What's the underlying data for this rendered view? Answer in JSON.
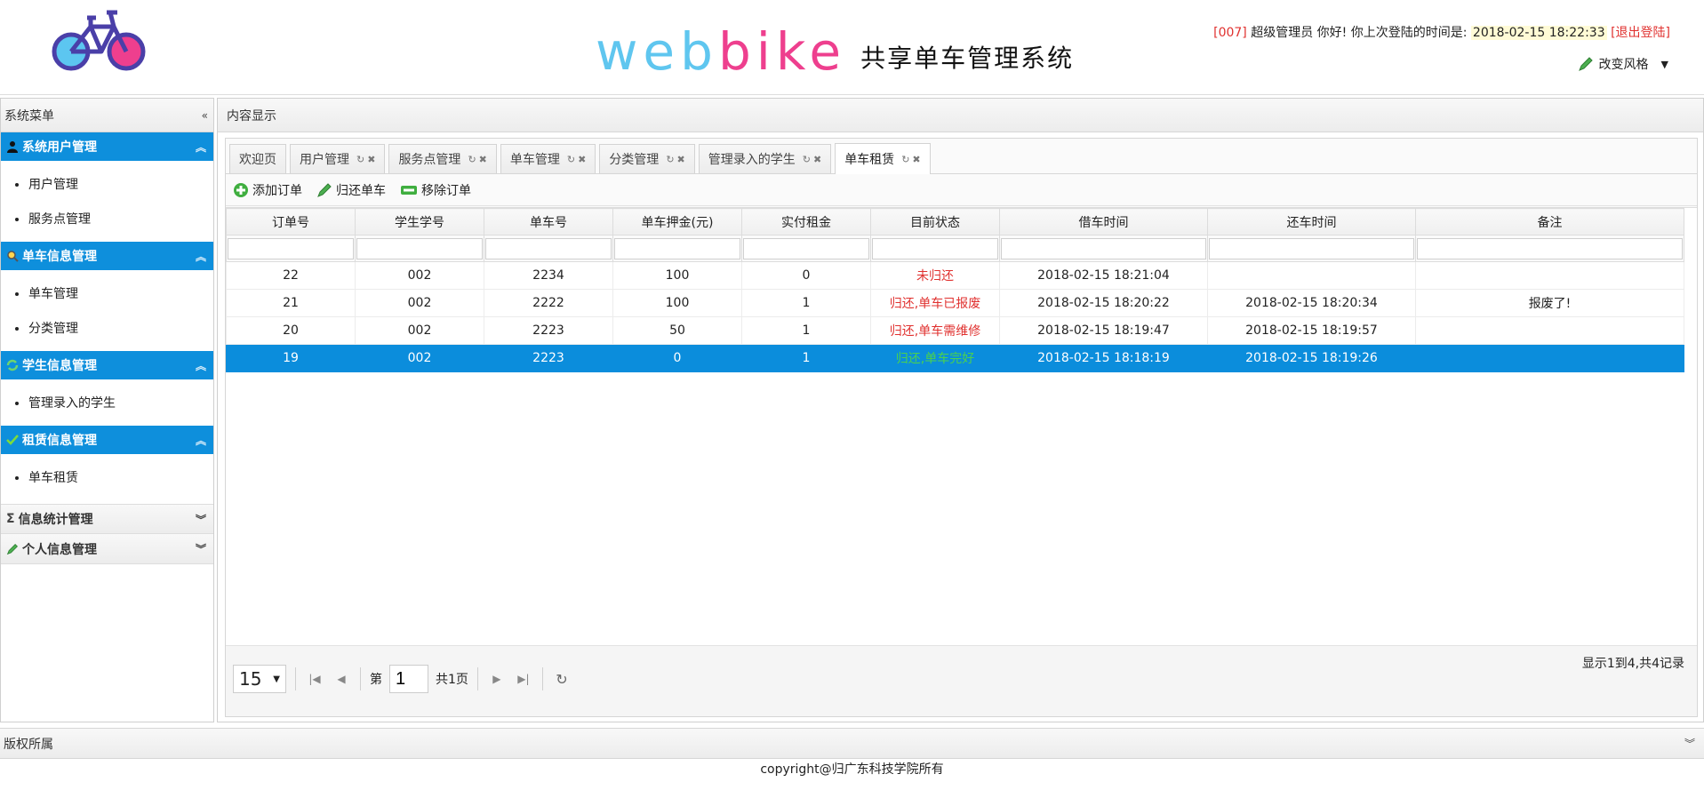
{
  "header": {
    "brand_part1": "web",
    "brand_part2": "ike",
    "brand_b": "b",
    "subtitle": "共享单车管理系统",
    "user_id": "[007]",
    "user_role": "超级管理员",
    "greeting": "你好! 你上次登陆的时间是:",
    "last_login": "2018-02-15 18:22:33",
    "logout": "[退出登陆]",
    "skin_label": "改变风格"
  },
  "sidebar": {
    "title": "系统菜单",
    "groups": [
      {
        "label": "系统用户管理",
        "icon": "user-icon",
        "items": [
          "用户管理",
          "服务点管理"
        ]
      },
      {
        "label": "单车信息管理",
        "icon": "search-icon",
        "items": [
          "单车管理",
          "分类管理"
        ]
      },
      {
        "label": "学生信息管理",
        "icon": "refresh-icon",
        "items": [
          "管理录入的学生"
        ]
      },
      {
        "label": "租赁信息管理",
        "icon": "check-icon",
        "items": [
          "单车租赁"
        ]
      },
      {
        "label": "信息统计管理",
        "icon": "sigma-icon",
        "items": []
      },
      {
        "label": "个人信息管理",
        "icon": "pencil-icon",
        "items": []
      }
    ]
  },
  "main": {
    "title": "内容显示",
    "tabs": [
      "欢迎页",
      "用户管理",
      "服务点管理",
      "单车管理",
      "分类管理",
      "管理录入的学生",
      "单车租赁"
    ],
    "toolbar": {
      "add": "添加订单",
      "return": "归还单车",
      "remove": "移除订单"
    },
    "columns": [
      "订单号",
      "学生学号",
      "单车号",
      "单车押金(元)",
      "实付租金",
      "目前状态",
      "借车时间",
      "还车时间",
      "备注"
    ],
    "rows": [
      [
        "22",
        "002",
        "2234",
        "100",
        "0",
        "未归还",
        "2018-02-15 18:21:04",
        "",
        ""
      ],
      [
        "21",
        "002",
        "2222",
        "100",
        "1",
        "归还,单车已报废",
        "2018-02-15 18:20:22",
        "2018-02-15 18:20:34",
        "报废了!"
      ],
      [
        "20",
        "002",
        "2223",
        "50",
        "1",
        "归还,单车需维修",
        "2018-02-15 18:19:47",
        "2018-02-15 18:19:57",
        ""
      ],
      [
        "19",
        "002",
        "2223",
        "0",
        "1",
        "归还,单车完好",
        "2018-02-15 18:18:19",
        "2018-02-15 18:19:26",
        ""
      ]
    ],
    "pager": {
      "page_size": "15",
      "page_prefix": "第",
      "page_value": "1",
      "page_total": "共1页",
      "summary": "显示1到4,共4记录"
    }
  },
  "footer": {
    "title": "版权所属",
    "copyright": "copyright@归广东科技学院所有"
  }
}
